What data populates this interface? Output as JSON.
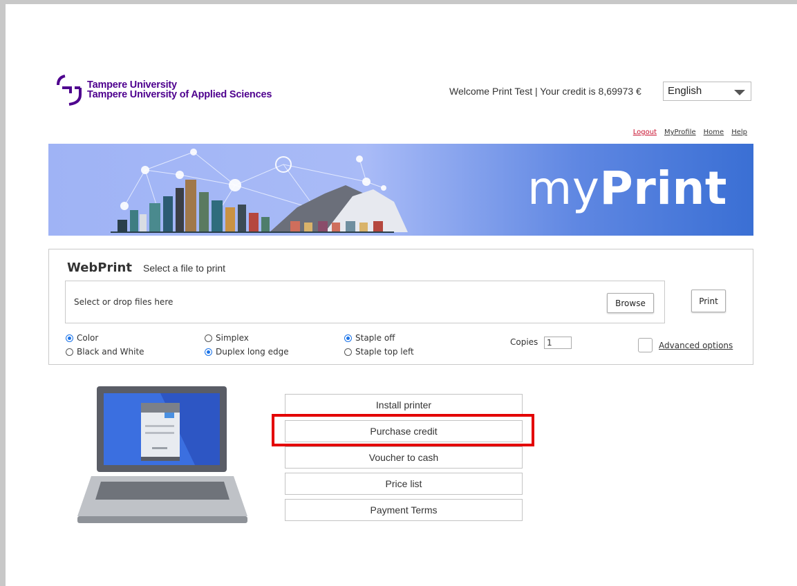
{
  "header": {
    "logo_line1": "Tampere University",
    "logo_line2": "Tampere University of Applied Sciences",
    "welcome": "Welcome Print Test | Your credit is 8,69973 €",
    "language": "English",
    "links": {
      "logout": "Logout",
      "profile": "MyProfile",
      "home": "Home",
      "help": "Help"
    }
  },
  "banner": {
    "title_light": "my",
    "title_bold": "Print"
  },
  "webprint": {
    "title": "WebPrint",
    "subtitle": "Select a file to print",
    "drop_text": "Select or drop files here",
    "browse_label": "Browse",
    "print_label": "Print",
    "options": {
      "color": "Color",
      "bw": "Black and White",
      "simplex": "Simplex",
      "duplex": "Duplex long edge",
      "staple_off": "Staple off",
      "staple_top_left": "Staple top left"
    },
    "copies_label": "Copies",
    "copies_value": "1",
    "advanced_label": "Advanced options"
  },
  "menu": {
    "install": "Install printer",
    "purchase": "Purchase credit",
    "voucher": "Voucher to cash",
    "price": "Price list",
    "terms": "Payment Terms"
  },
  "colors": {
    "brand": "#4e008e",
    "accent": "#1a73e8",
    "highlight": "#e30000"
  }
}
